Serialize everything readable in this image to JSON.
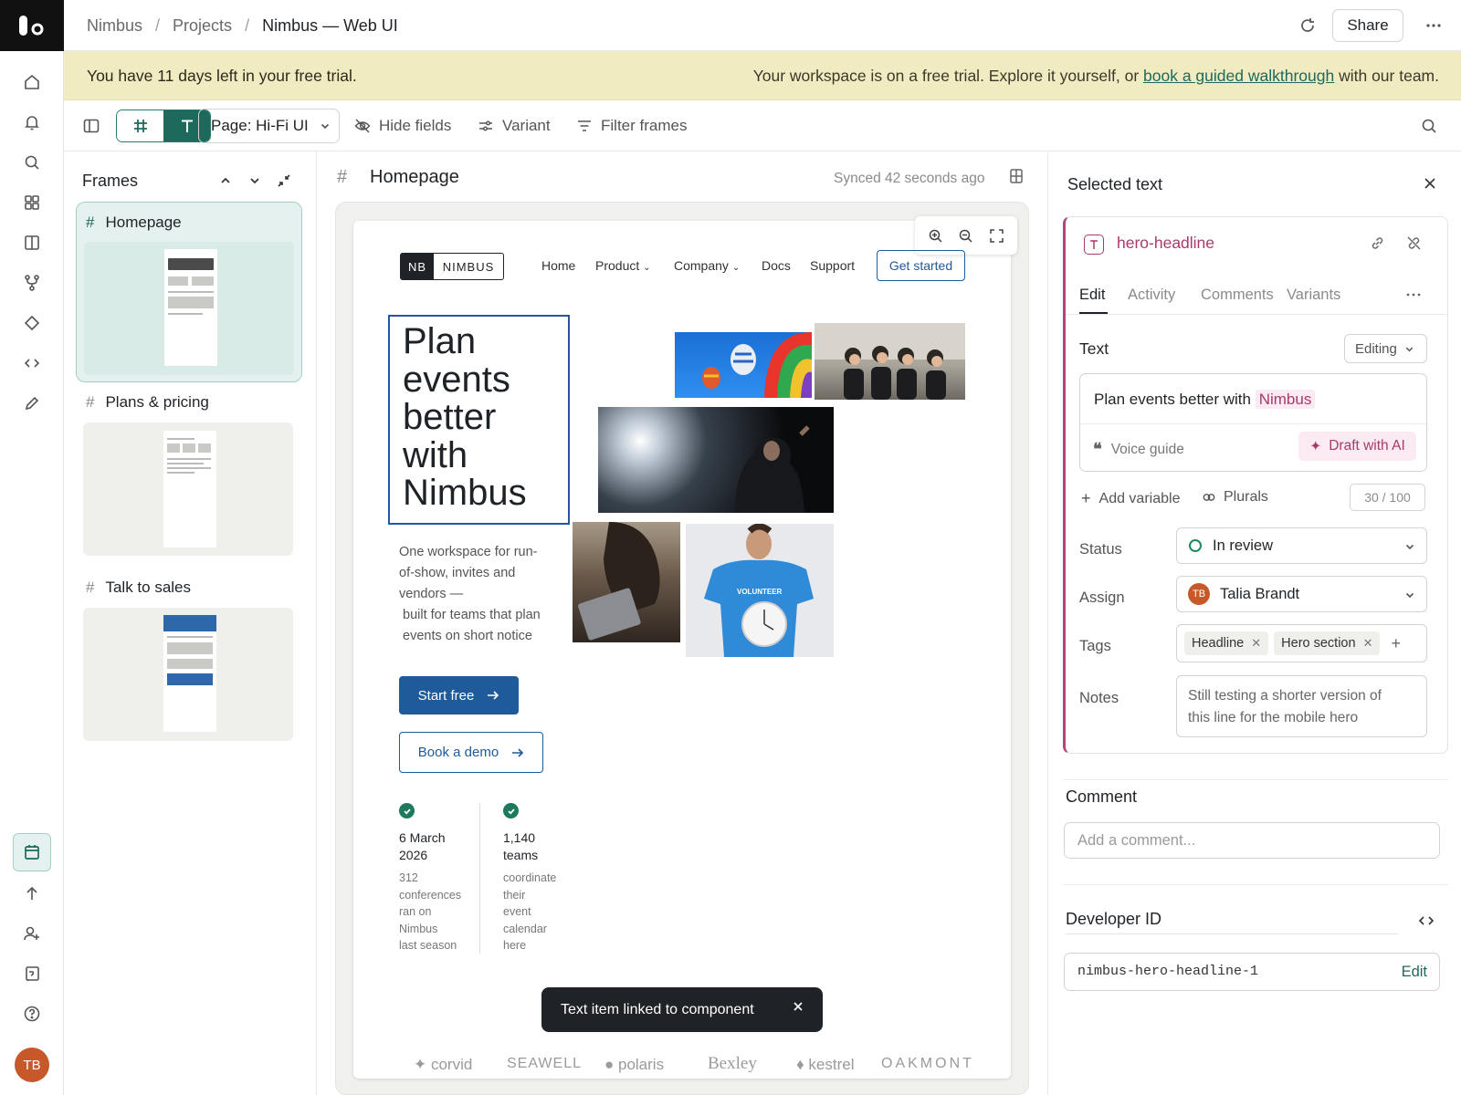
{
  "app": {
    "logo": "notion-style-logo",
    "user_initials": "TB"
  },
  "breadcrumbs": [
    "Nimbus",
    "Projects",
    "Nimbus — Web UI"
  ],
  "topbar": {
    "share_label": "Share"
  },
  "banner": {
    "left_text": "You have 11 days left in your free trial.",
    "right_prefix": "Your workspace is on a free trial. Explore it yourself, or ",
    "right_link": "book a guided walkthrough",
    "right_suffix": " with our team."
  },
  "toolbar": {
    "page_select": "Page: Hi-Fi UI",
    "hide_fields": "Hide fields",
    "variant": "Variant",
    "filter_frames": "Filter frames"
  },
  "frames": {
    "title": "Frames",
    "items": [
      {
        "label": "Homepage",
        "selected": true
      },
      {
        "label": "Plans & pricing",
        "selected": false
      },
      {
        "label": "Talk to sales",
        "selected": false
      }
    ]
  },
  "canvas": {
    "frame_title": "Homepage",
    "synced": "Synced 42 seconds ago"
  },
  "site": {
    "logo_mark": "NB",
    "logo_name": "NIMBUS",
    "nav": [
      "Home",
      "Product",
      "Company",
      "Docs",
      "Support"
    ],
    "cta": "Get started",
    "hero_lines": [
      "Plan",
      "events",
      "better",
      "with",
      "Nimbus"
    ],
    "subtext_lines": [
      "One workspace for run-",
      "of-show, invites and",
      "vendors —",
      " built for teams that plan",
      " events on short notice"
    ],
    "start_free": "Start free",
    "book_demo": "Book a demo",
    "stats": [
      {
        "big": [
          "6 March",
          "2026"
        ],
        "small": [
          "312",
          "conferences",
          "ran on",
          "Nimbus",
          "last season"
        ]
      },
      {
        "big": [
          "1,140",
          "teams"
        ],
        "small": [
          "coordinate",
          "their",
          "event",
          "calendar",
          "here"
        ]
      }
    ],
    "brands": [
      "corvid",
      "SEAWELL",
      "polaris",
      "Bexley",
      "kestrel",
      "OAKMONT"
    ],
    "volunteer_shirt": "VOLUNTEER"
  },
  "toast": {
    "text": "Text item linked to component"
  },
  "panel": {
    "title": "Selected text",
    "item_name": "hero-headline",
    "tabs": [
      "Edit",
      "Activity",
      "Comments",
      "Variants"
    ],
    "text_label": "Text",
    "mode": "Editing",
    "text_value_prefix": "Plan events better with ",
    "text_value_variable": "Nimbus",
    "voice_guide": "Voice guide",
    "draft_ai": "Draft with AI",
    "add_variable": "Add variable",
    "plurals": "Plurals",
    "counter": "30 / 100",
    "status_label": "Status",
    "status_value": "In review",
    "assign_label": "Assign",
    "assignee_initials": "TB",
    "assignee": "Talia Brandt",
    "tags_label": "Tags",
    "tags": [
      "Headline",
      "Hero section"
    ],
    "notes_label": "Notes",
    "notes_lines": [
      "Still testing a shorter version of",
      "this line for the mobile hero"
    ],
    "comment_label": "Comment",
    "comment_placeholder": "Add a comment...",
    "developer_label": "Developer ID",
    "developer_id": "nimbus-hero-headline-1",
    "developer_edit": "Edit"
  },
  "colors": {
    "accent": "#1d6a5c",
    "banner": "#f1ebc1",
    "site_blue": "#1f5a9a",
    "variable_pink": "#a83a6c"
  }
}
